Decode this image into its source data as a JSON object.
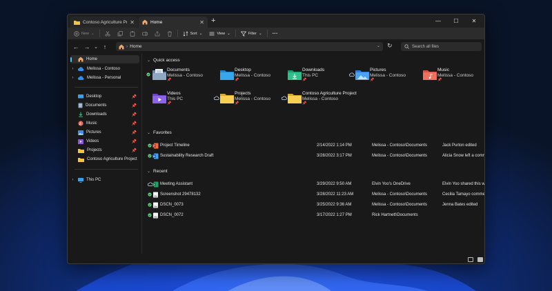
{
  "tabs": [
    {
      "label": "Contoso Agriculture Project",
      "close": "✕"
    },
    {
      "label": "Home",
      "close": "✕"
    }
  ],
  "new_tab": "+",
  "window_controls": {
    "minimize": "—",
    "maximize": "☐",
    "close": "✕"
  },
  "commands": {
    "new": "New",
    "sort": "Sort",
    "view": "View",
    "filter": "Filter",
    "more": "···"
  },
  "nav": {
    "back": "←",
    "forward": "→",
    "down": "⌄",
    "up": "↑",
    "path_sep": "›",
    "path": "Home",
    "refresh": "↻",
    "search_placeholder": "Search all files"
  },
  "sidebar": {
    "home": "Home",
    "accounts": [
      "Melissa - Contoso",
      "Melissa - Personal"
    ],
    "pinned": [
      "Desktop",
      "Documents",
      "Downloads",
      "Music",
      "Pictures",
      "Videos",
      "Projects",
      "Contoso Agriculture Project"
    ],
    "this_pc": "This PC"
  },
  "quick_access": {
    "title": "Quick access",
    "items": [
      {
        "name": "Documents",
        "sub": "Melissa - Contoso",
        "icon": "documents-folder-icon",
        "status": "synced"
      },
      {
        "name": "Desktop",
        "sub": "Melissa - Contoso",
        "icon": "desktop-folder-icon",
        "status": "none"
      },
      {
        "name": "Downloads",
        "sub": "This PC",
        "icon": "downloads-folder-icon",
        "status": "none"
      },
      {
        "name": "Pictures",
        "sub": "Melissa - Contoso",
        "icon": "pictures-folder-icon",
        "status": "cloud"
      },
      {
        "name": "Music",
        "sub": "Melissa - Contoso",
        "icon": "music-folder-icon",
        "status": "none"
      },
      {
        "name": "Videos",
        "sub": "This PC",
        "icon": "videos-folder-icon",
        "status": "none"
      },
      {
        "name": "Projects",
        "sub": "Melissa - Contoso",
        "icon": "folder-icon",
        "status": "cloud"
      },
      {
        "name": "Contoso Agriculture Project",
        "sub": "Melissa - Contoso",
        "icon": "folder-icon",
        "status": "cloud"
      }
    ],
    "pin": "📌"
  },
  "favorites": {
    "title": "Favorites",
    "rows": [
      {
        "name": "Project Timeline",
        "date": "2/14/2022 1:14 PM",
        "location": "Melissa - Contoso\\Documents",
        "activity": "Jack Purton edited",
        "icon": "powerpoint-icon"
      },
      {
        "name": "Sustainability Research Draft",
        "date": "3/28/2022 3:17 PM",
        "location": "Melissa - Contoso\\Documents",
        "activity": "Alicia Snow left a comment",
        "icon": "word-icon"
      }
    ]
  },
  "recent": {
    "title": "Recent",
    "rows": [
      {
        "name": "Meeting Assistant",
        "date": "3/29/2022 9:50 AM",
        "location": "Elvin Yoo's OneDrive",
        "activity": "Elvin Yoo shared this with you",
        "icon": "excel-icon",
        "status": "cloud"
      },
      {
        "name": "Screenshot 29478132",
        "date": "3/28/2022 11:23 AM",
        "location": "Melissa - Contoso\\Documents",
        "activity": "Cecilia Tamayo commented",
        "icon": "image-file-icon",
        "status": "synced"
      },
      {
        "name": "DSCN_0073",
        "date": "3/25/2022 9:36 AM",
        "location": "Melissa - Contoso\\Documents",
        "activity": "Jenna Bates edited",
        "icon": "image-file-icon",
        "status": "synced"
      },
      {
        "name": "DSCN_0072",
        "date": "3/17/2022 1:27 PM",
        "location": "Rick Hartnett\\Documents",
        "activity": "",
        "icon": "image-file-icon",
        "status": "synced"
      }
    ]
  },
  "colors": {
    "accent": "#4cc2ff",
    "folder": "#f2c33f",
    "synced": "#5fcf7e"
  }
}
